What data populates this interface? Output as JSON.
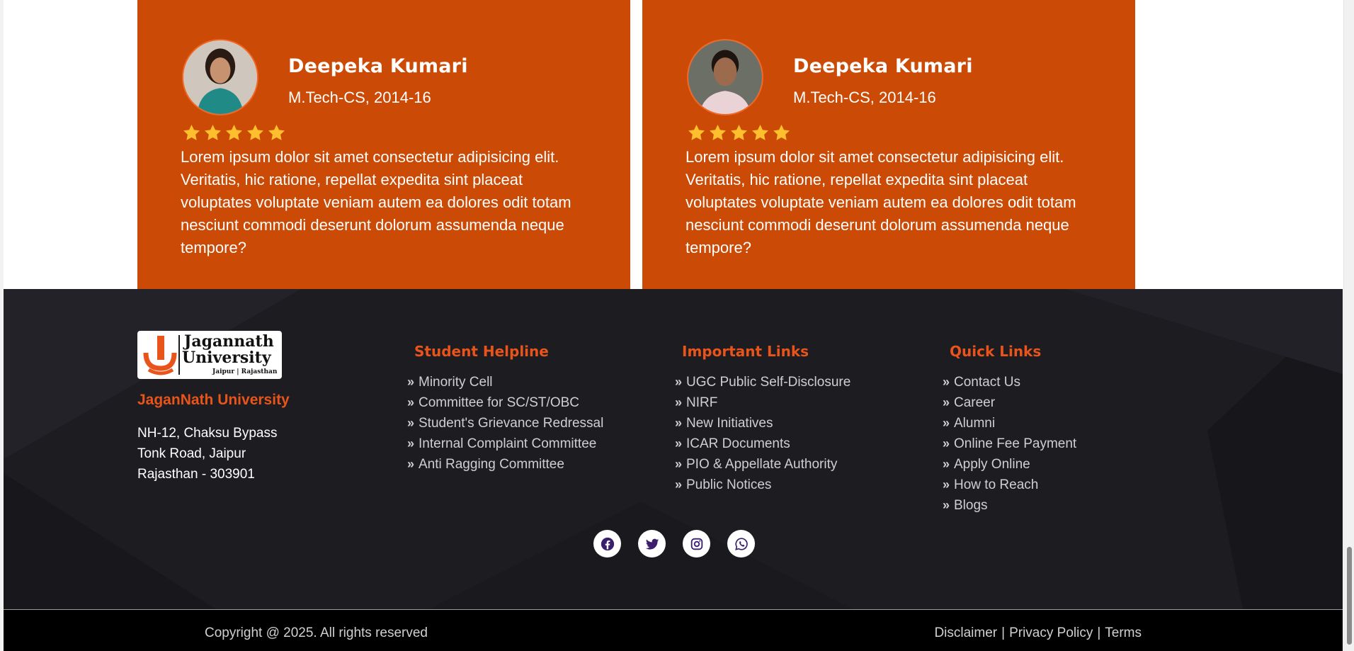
{
  "testimonials": [
    {
      "name": "Deepeka Kumari",
      "role": "M.Tech-CS, 2014-16",
      "rating": 5,
      "text": "Lorem ipsum dolor sit amet consectetur adipisicing elit. Veritatis, hic ratione, repellat expedita sint placeat voluptates voluptate veniam autem ea dolores odit totam nesciunt commodi deserunt dolorum assumenda neque tempore?"
    },
    {
      "name": "Deepeka Kumari",
      "role": "M.Tech-CS, 2014-16",
      "rating": 5,
      "text": "Lorem ipsum dolor sit amet consectetur adipisicing elit. Veritatis, hic ratione, repellat expedita sint placeat voluptates voluptate veniam autem ea dolores odit totam nesciunt commodi deserunt dolorum assumenda neque tempore?"
    }
  ],
  "footer": {
    "logo": {
      "line1": "Jagannath",
      "line2": "University",
      "line3": "Jaipur | Rajasthan"
    },
    "university_name": "JaganNath University",
    "address": [
      "NH-12, Chaksu Bypass",
      "Tonk Road, Jaipur",
      "Rajasthan - 303901"
    ],
    "student_helpline": {
      "title": "Student Helpline",
      "items": [
        "Minority Cell",
        "Committee for SC/ST/OBC",
        "Student's Grievance Redressal",
        "Internal Complaint Committee",
        "Anti Ragging Committee"
      ]
    },
    "important_links": {
      "title": "Important Links",
      "items": [
        "UGC Public Self-Disclosure",
        "NIRF",
        "New Initiatives",
        "ICAR Documents",
        "PIO & Appellate Authority",
        "Public Notices"
      ]
    },
    "quick_links": {
      "title": "Quick Links",
      "items": [
        "Contact Us",
        "Career",
        "Alumni",
        "Online Fee Payment",
        "Apply Online",
        "How to Reach",
        "Blogs"
      ]
    },
    "socials": [
      "facebook-icon",
      "twitter-icon",
      "instagram-icon",
      "whatsapp-icon"
    ]
  },
  "bottom_bar": {
    "copyright": "Copyright @ 2025. All rights reserved",
    "links": [
      "Disclaimer",
      "Privacy Policy",
      "Terms"
    ]
  },
  "colors": {
    "card_bg": "#cb4b06",
    "accent": "#e8541a",
    "footer_bg": "#1d1c21",
    "star": "#fdbf2d",
    "social_icon": "#3b1f6e"
  }
}
